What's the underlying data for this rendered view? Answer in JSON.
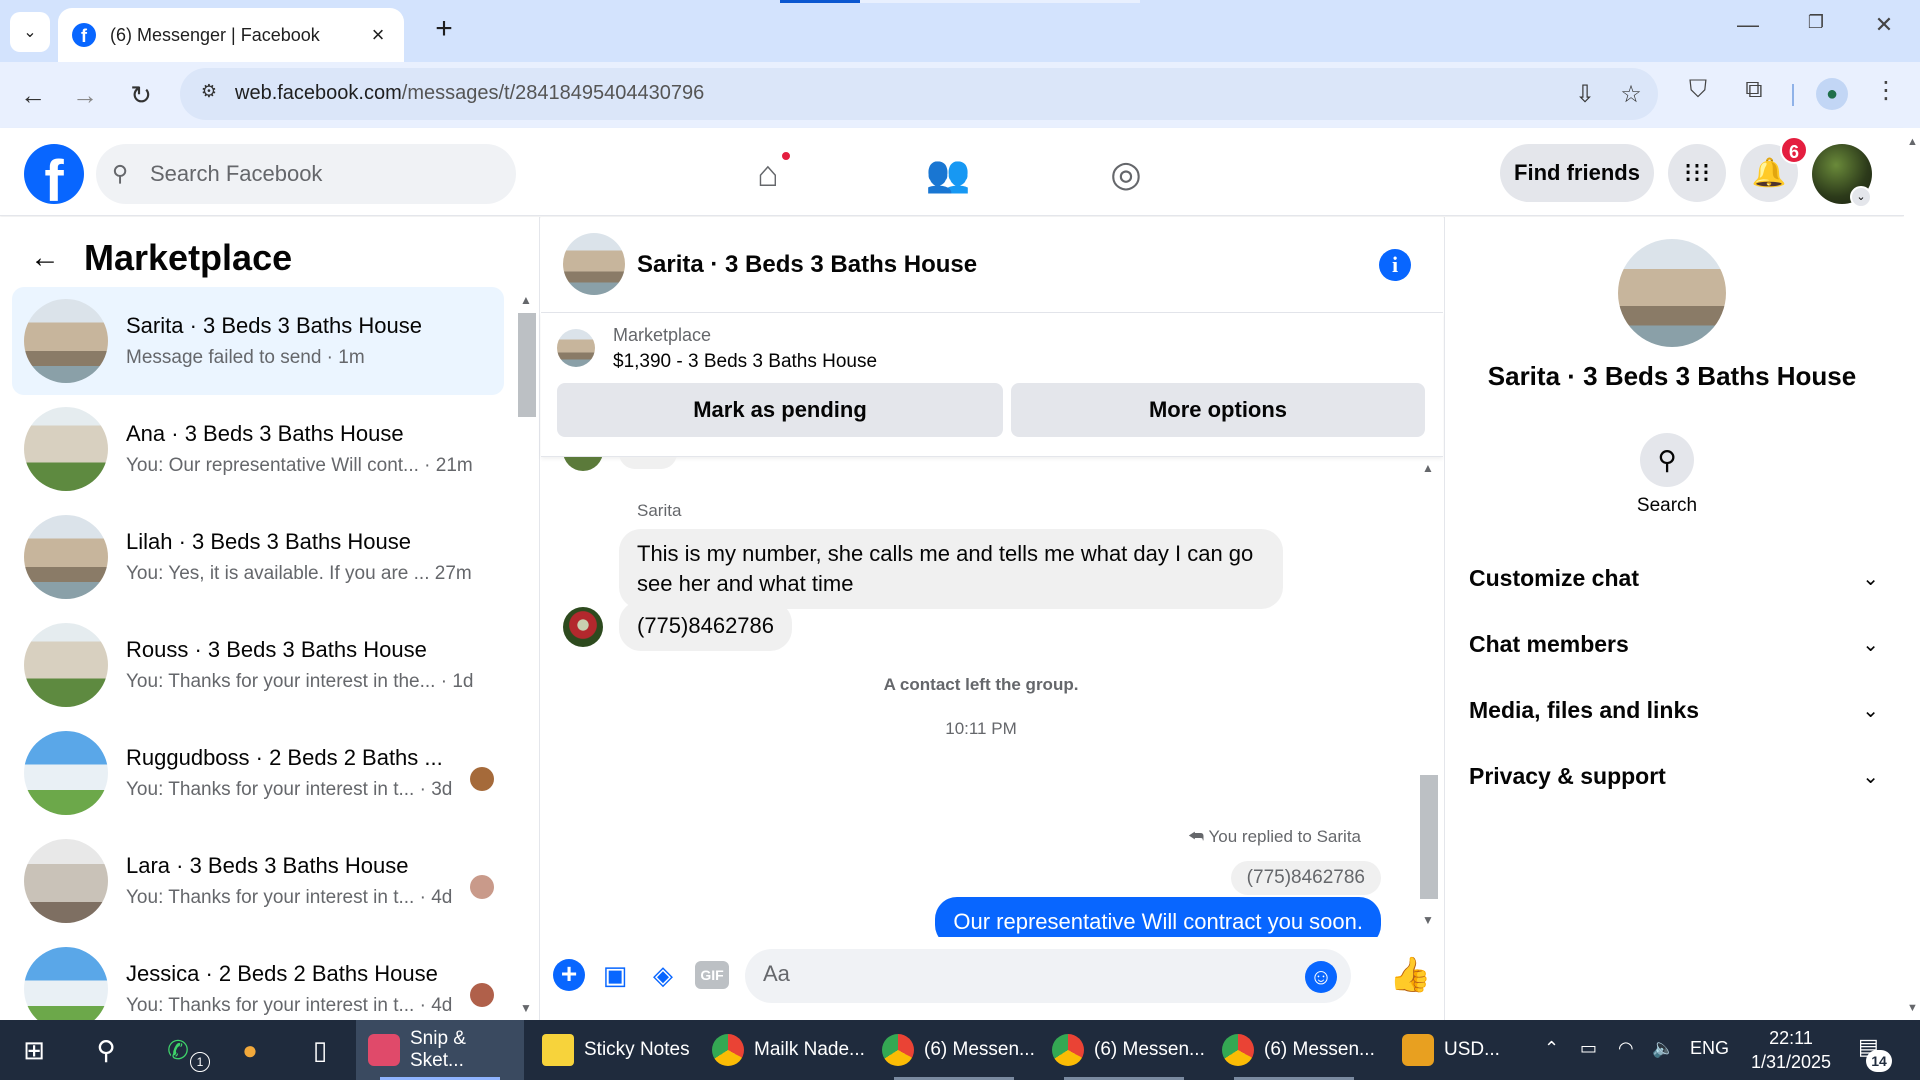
{
  "browser": {
    "tab_title": "(6) Messenger | Facebook",
    "url_host": "web.facebook.com",
    "url_path": "/messages/t/28418495404430796"
  },
  "fb": {
    "search_placeholder": "Search Facebook",
    "find_friends": "Find friends",
    "notifications_count": "6"
  },
  "left": {
    "title": "Marketplace",
    "chats": [
      {
        "name": "Sarita · 3 Beds 3 Baths House",
        "sub": "Message failed to send · 1m"
      },
      {
        "name": "Ana · 3 Beds 3 Baths House",
        "sub": "You: Our representative Will cont... · 21m"
      },
      {
        "name": "Lilah · 3 Beds 3 Baths House",
        "sub": "You: Yes, it is available. If you are ...  27m"
      },
      {
        "name": "Rouss · 3 Beds 3 Baths House",
        "sub": "You: Thanks for your interest in the... · 1d"
      },
      {
        "name": "Ruggudboss · 2 Beds 2 Baths ...",
        "sub": "You: Thanks for your interest in t... · 3d"
      },
      {
        "name": "Lara · 3 Beds 3 Baths House",
        "sub": "You: Thanks for your interest in t... · 4d"
      },
      {
        "name": "Jessica · 2 Beds 2 Baths House",
        "sub": "You: Thanks for your interest in t... · 4d"
      }
    ]
  },
  "chat": {
    "header_name": "Sarita · 3 Beds 3 Baths House",
    "marketplace_label": "Marketplace",
    "listing": "$1,390 - 3 Beds 3 Baths House",
    "mark_pending": "Mark as pending",
    "more_options": "More options",
    "partial_msg": "Ok",
    "sender": "Sarita",
    "msg1": "This is my number, she calls me and tells me what day I can go see her and what time",
    "msg2": "(775)8462786",
    "system": "A contact left the group.",
    "time": "10:11 PM",
    "replied": "You replied to Sarita",
    "quoted": "(775)8462786",
    "outgoing": "Our representative Will contract you soon.",
    "composer_placeholder": "Aa",
    "gif": "GIF"
  },
  "right": {
    "name": "Sarita · 3 Beds 3 Baths House",
    "search_label": "Search",
    "sections": [
      "Customize chat",
      "Chat members",
      "Media, files and links",
      "Privacy & support"
    ]
  },
  "taskbar": {
    "apps": [
      "Snip & Sket...",
      "Sticky Notes",
      "Mailk Nade...",
      "(6) Messen...",
      "(6) Messen...",
      "(6) Messen...",
      "USD..."
    ],
    "lang": "ENG",
    "time": "22:11",
    "date": "1/31/2025",
    "whatsapp_badge": "1",
    "notif_count": "14"
  },
  "colors": {
    "fb_blue": "#0866ff",
    "active_chat": "#ebf5ff",
    "badge_red": "#e41e3f"
  }
}
